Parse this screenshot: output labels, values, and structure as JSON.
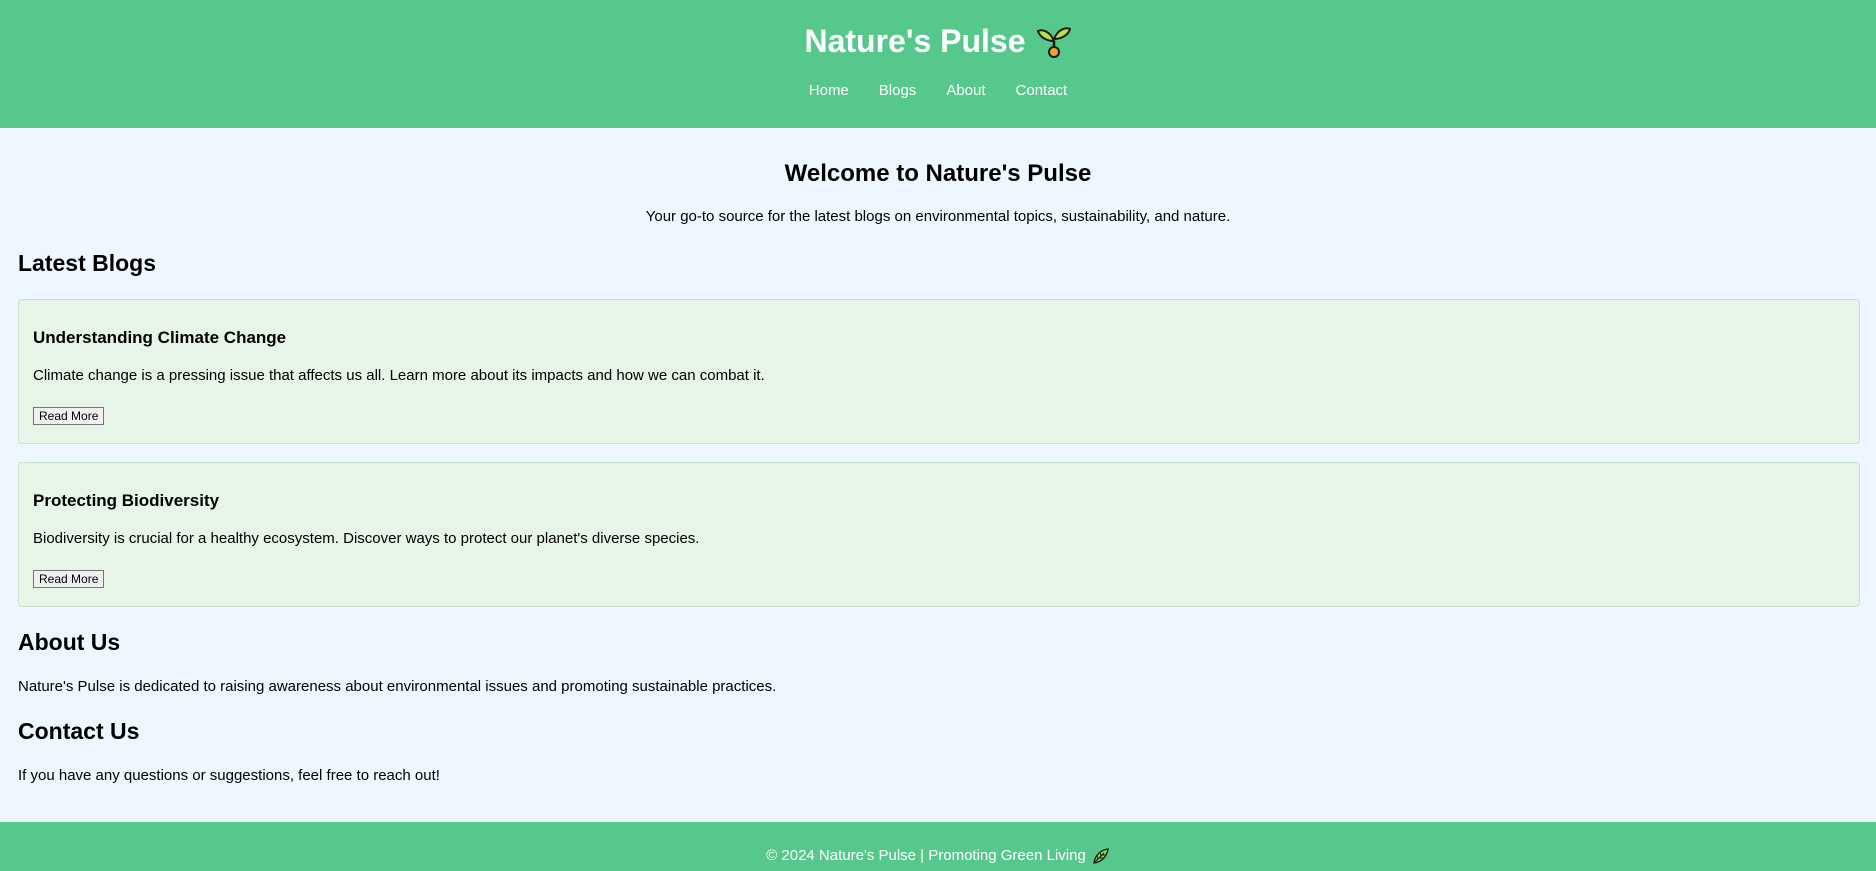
{
  "header": {
    "title": "Nature's Pulse",
    "title_icon": "sprout-icon",
    "nav": [
      {
        "label": "Home"
      },
      {
        "label": "Blogs"
      },
      {
        "label": "About"
      },
      {
        "label": "Contact"
      }
    ]
  },
  "hero": {
    "title": "Welcome to Nature's Pulse",
    "subtitle": "Your go-to source for the latest blogs on environmental topics, sustainability, and nature."
  },
  "blogs": {
    "heading": "Latest Blogs",
    "items": [
      {
        "title": "Understanding Climate Change",
        "summary": "Climate change is a pressing issue that affects us all. Learn more about its impacts and how we can combat it.",
        "button_label": "Read More"
      },
      {
        "title": "Protecting Biodiversity",
        "summary": "Biodiversity is crucial for a healthy ecosystem. Discover ways to protect our planet's diverse species.",
        "button_label": "Read More"
      }
    ]
  },
  "about": {
    "heading": "About Us",
    "text": "Nature's Pulse is dedicated to raising awareness about environmental issues and promoting sustainable practices."
  },
  "contact": {
    "heading": "Contact Us",
    "text": "If you have any questions or suggestions, feel free to reach out!"
  },
  "footer": {
    "text": "© 2024 Nature's Pulse | Promoting Green Living",
    "icon": "leaf-icon"
  },
  "colors": {
    "header_bg": "#57c88b",
    "page_bg": "#eef7ff",
    "card_bg": "#e6f5e8"
  }
}
